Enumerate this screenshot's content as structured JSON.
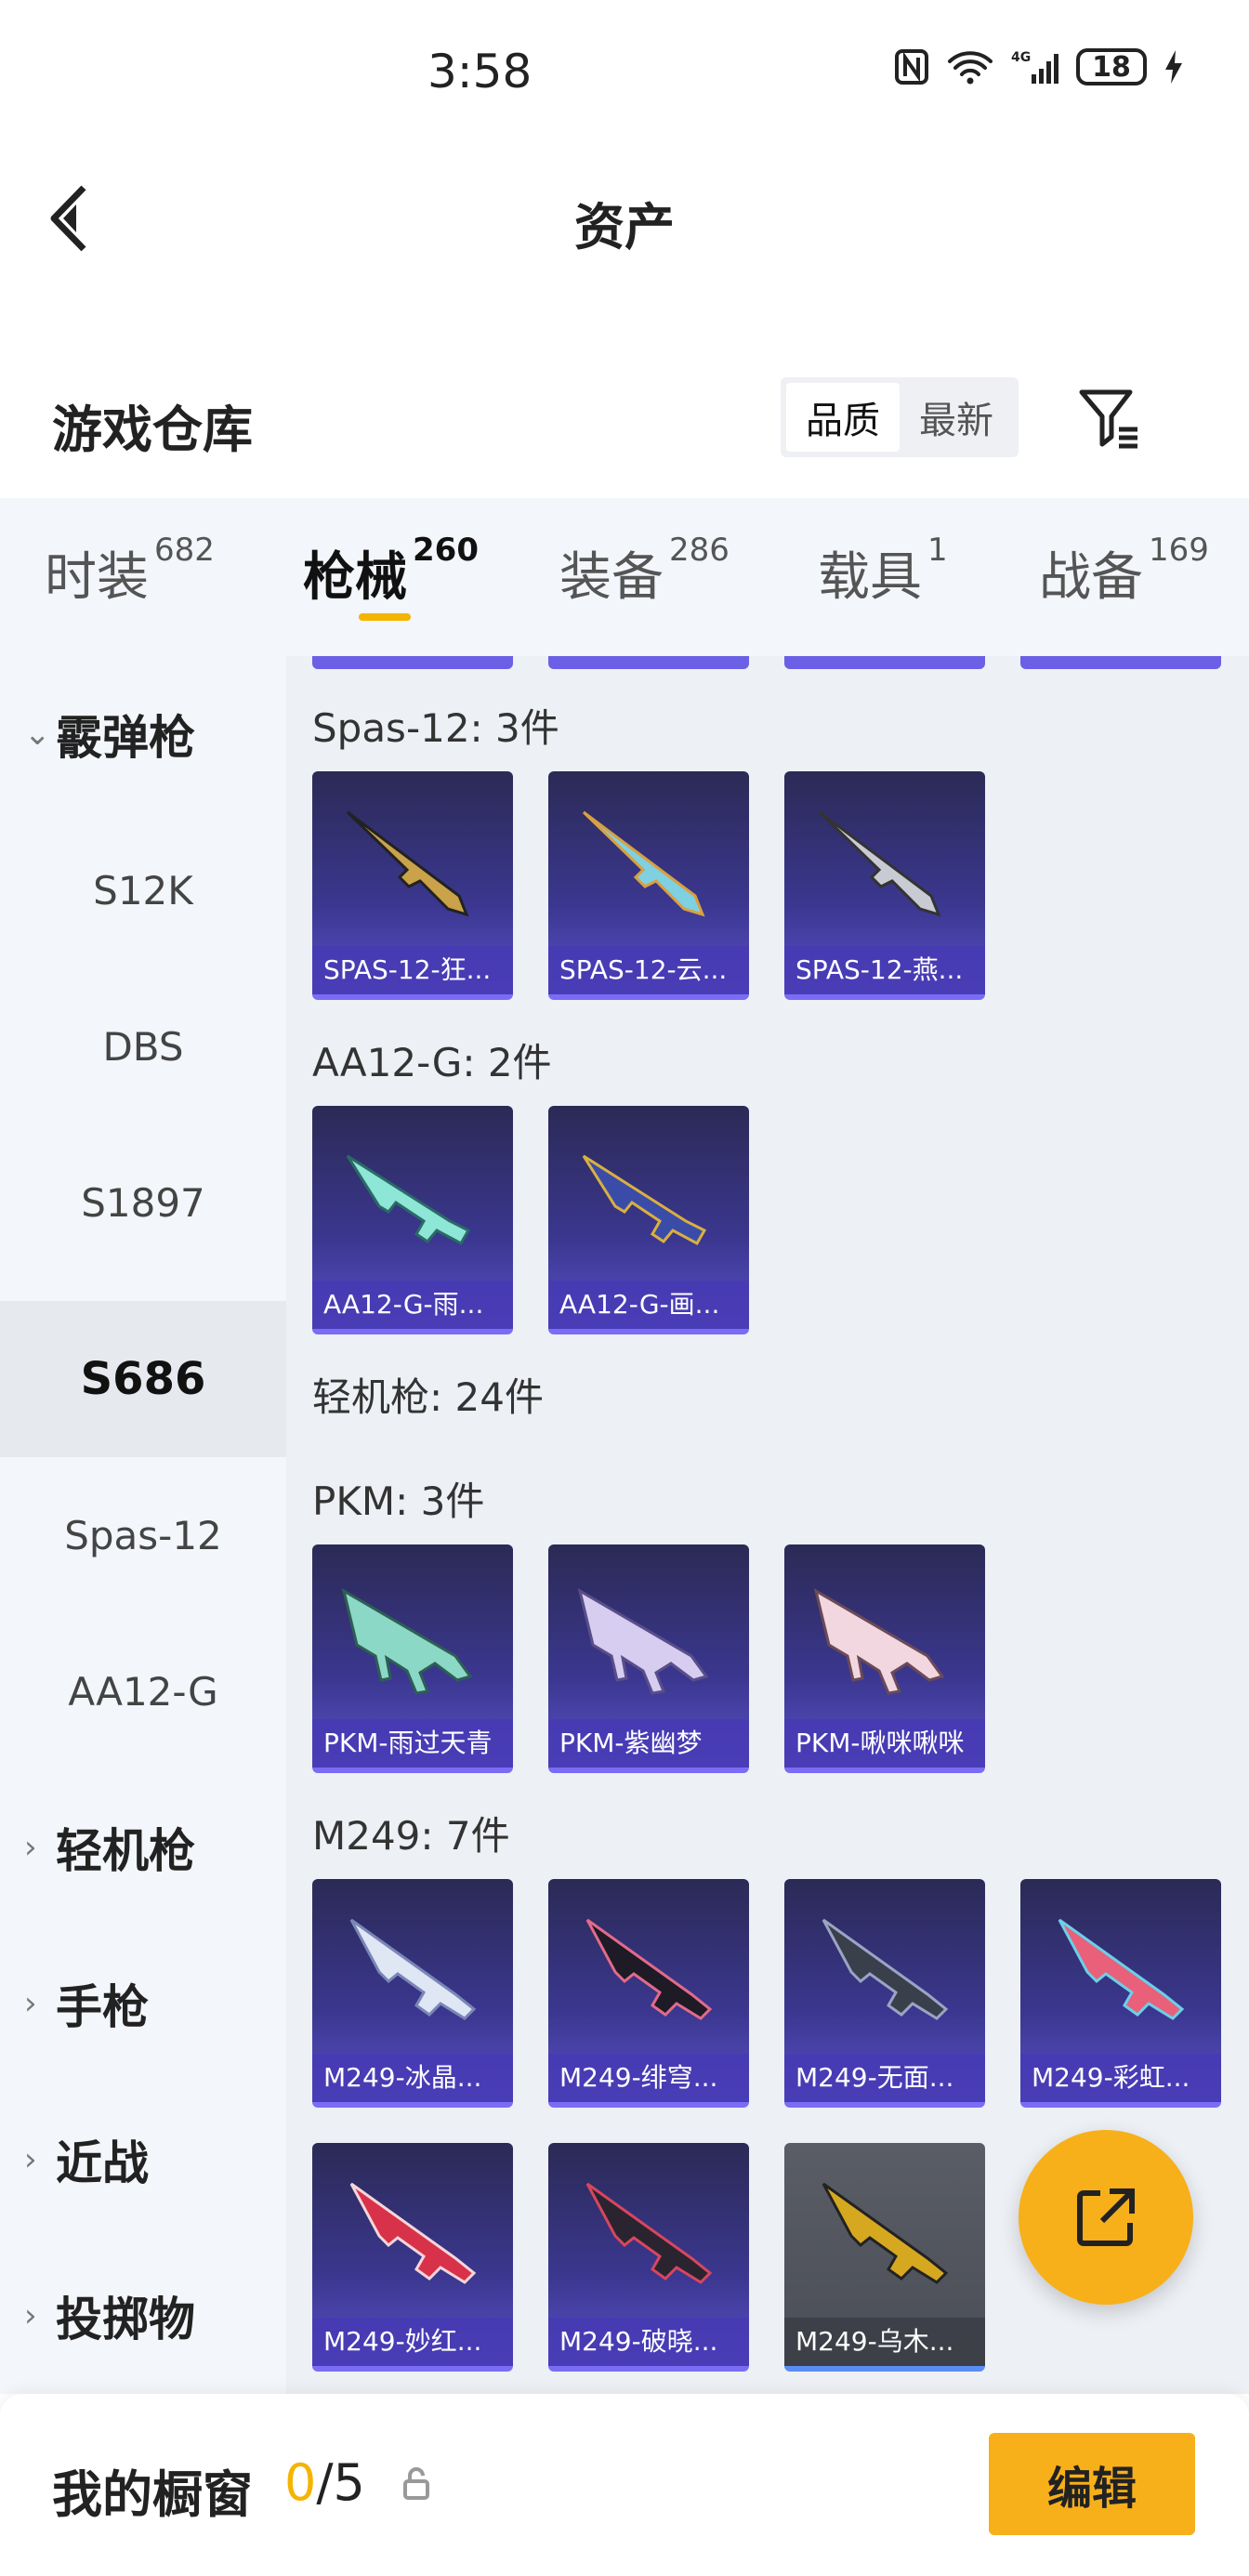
{
  "status_bar": {
    "time": "3:58",
    "battery": "18"
  },
  "header": {
    "title": "资产"
  },
  "warehouse": {
    "title": "游戏仓库",
    "sort_options": [
      "品质",
      "最新"
    ]
  },
  "tabs": [
    {
      "label": "时装",
      "count": "682"
    },
    {
      "label": "枪械",
      "count": "260"
    },
    {
      "label": "装备",
      "count": "286"
    },
    {
      "label": "载具",
      "count": "1"
    },
    {
      "label": "战备",
      "count": "169"
    }
  ],
  "sidebar": {
    "items": [
      {
        "label": "霰弹枪",
        "type": "category",
        "expanded": true
      },
      {
        "label": "S12K"
      },
      {
        "label": "DBS"
      },
      {
        "label": "S1897"
      },
      {
        "label": "S686",
        "active": true
      },
      {
        "label": "Spas-12"
      },
      {
        "label": "AA12-G"
      },
      {
        "label": "轻机枪",
        "type": "category"
      },
      {
        "label": "手枪",
        "type": "category"
      },
      {
        "label": "近战",
        "type": "category"
      },
      {
        "label": "投掷物",
        "type": "category"
      }
    ]
  },
  "groups": [
    {
      "label": "Spas-12: 3件",
      "items": [
        "SPAS-12-狂...",
        "SPAS-12-云...",
        "SPAS-12-燕..."
      ]
    },
    {
      "label": "AA12-G: 2件",
      "items": [
        "AA12-G-雨...",
        "AA12-G-画..."
      ]
    },
    {
      "label": "轻机枪: 24件"
    },
    {
      "label": "PKM: 3件",
      "items": [
        "PKM-雨过天青",
        "PKM-紫幽梦",
        "PKM-啾咪啾咪"
      ]
    },
    {
      "label": "M249: 7件",
      "items": [
        "M249-冰晶...",
        "M249-绯穹...",
        "M249-无面...",
        "M249-彩虹...",
        "M249-妙红...",
        "M249-破晓...",
        "M249-乌木..."
      ]
    }
  ],
  "bottom_bar": {
    "label": "我的橱窗",
    "count_current": "0",
    "count_total": "/5",
    "edit_label": "编辑"
  },
  "colors": {
    "accent": "#f7b01a",
    "card_purple": "#3b3790"
  }
}
